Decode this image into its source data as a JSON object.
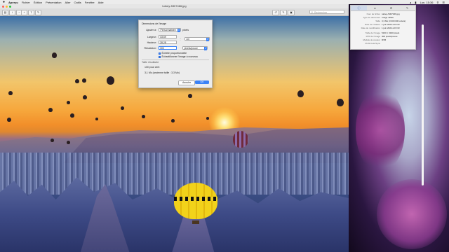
{
  "menubar": {
    "apple": "",
    "items": [
      "Aperçu",
      "Fichier",
      "Édition",
      "Présentation",
      "Aller",
      "Outils",
      "Fenêtre",
      "Aide"
    ],
    "clock": "Lun. 15:36"
  },
  "window": {
    "title": "turkey-5307466.jpg",
    "search_placeholder": "Rechercher"
  },
  "dialog": {
    "section_title": "Dimensions de l'image",
    "fit_label": "Ajuster à :",
    "fit_value": "Personnalisée",
    "fit_unit": "pixels",
    "width_label": "Largeur :",
    "width_value": "43,69",
    "height_label": "Hauteur :",
    "height_value": "28,28",
    "units_value": "cm",
    "resolution_label": "Résolution :",
    "resolution_value": "300",
    "resolution_unit": "pixels/pouce",
    "proportional_label": "Échelle proportionnelle",
    "resample_label": "Échantillonner l'image à nouveau",
    "result_title": "Taille résultante",
    "result_line1": "100 pour cent",
    "result_line2": "3,1 Mo (ancienne taille : 3,3 Mo)",
    "cancel_label": "Annuler",
    "ok_label": "OK"
  },
  "inspector": {
    "rows": [
      {
        "k": "Nom de fichier",
        "v": "turkey-5307466.jpg"
      },
      {
        "k": "Type de document",
        "v": "Image JPEG"
      },
      {
        "k": "Taille",
        "v": "3,3 Mo (3 300 000 octets)"
      },
      {
        "k": "Date de création",
        "v": "1 juin 2024 à 15:33"
      },
      {
        "k": "Date de modification",
        "v": "1 juin 2024 à 15:33"
      },
      {
        "k": "Taille de l'image",
        "v": "5160 × 3340 pixels"
      },
      {
        "k": "PPP de l'image",
        "v": "300 pixels/pouce"
      },
      {
        "k": "Modèle de couleur",
        "v": "RVB"
      },
      {
        "k": "Profil ColorSync",
        "v": ""
      }
    ]
  },
  "colors": {
    "accent": "#3b82f6",
    "menubar": "#ececec",
    "sheet": "#ececec"
  }
}
